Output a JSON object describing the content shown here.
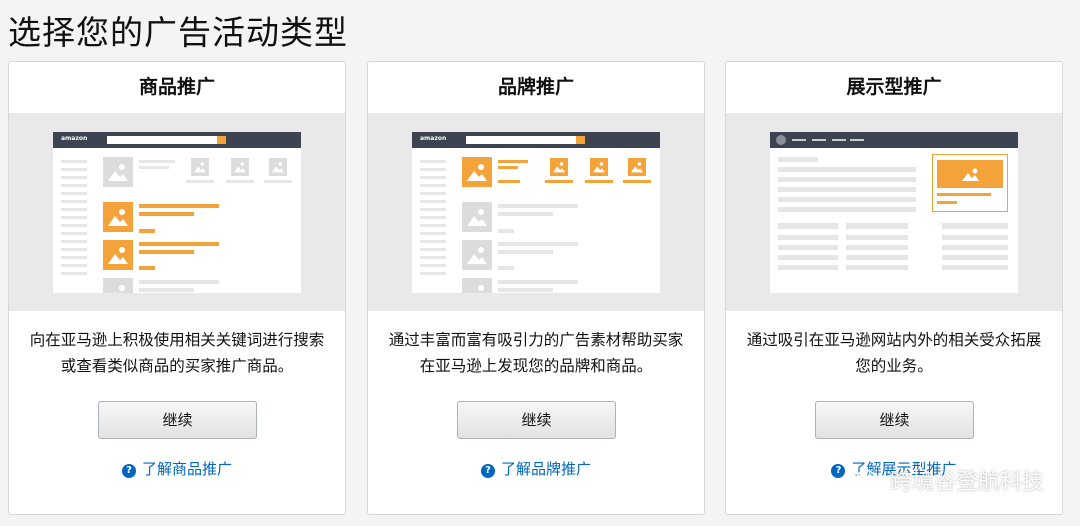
{
  "page": {
    "title": "选择您的广告活动类型"
  },
  "cards": [
    {
      "title": "商品推广",
      "description": "向在亚马逊上积极使用相关关键词进行搜索或查看类似商品的买家推广商品。",
      "button_label": "继续",
      "learn_more": "了解商品推广",
      "mock_logo": "amazon"
    },
    {
      "title": "品牌推广",
      "description": "通过丰富而富有吸引力的广告素材帮助买家在亚马逊上发现您的品牌和商品。",
      "button_label": "继续",
      "learn_more": "了解品牌推广",
      "mock_logo": "amazon"
    },
    {
      "title": "展示型推广",
      "description": "通过吸引在亚马逊网站内外的相关受众拓展您的业务。",
      "button_label": "继续",
      "learn_more": "了解展示型推广"
    }
  ],
  "watermark": {
    "text": "跨境谷登航科技",
    "icon": "wechat-icon"
  },
  "colors": {
    "accent_orange": "#f3a33a",
    "link_blue": "#0066c0",
    "topbar": "#3d4350"
  }
}
